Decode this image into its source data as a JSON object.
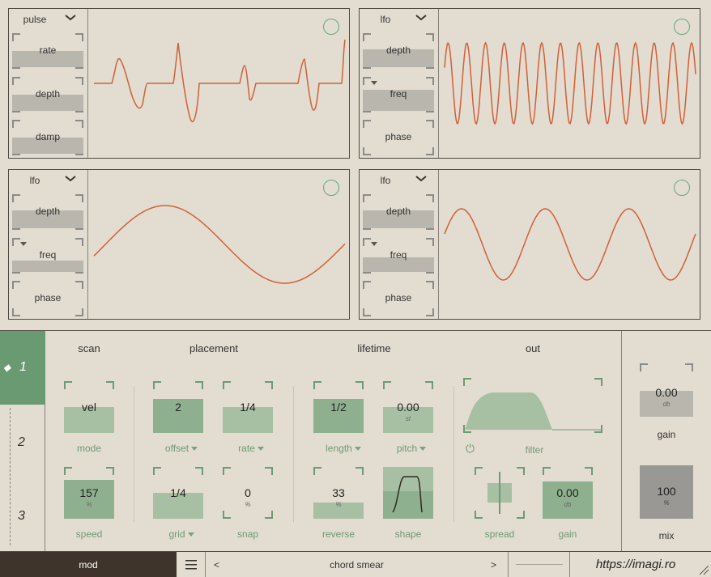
{
  "panels": [
    {
      "source": "pulse",
      "knobs": [
        {
          "label": "rate",
          "fill": 0.5,
          "arrow": false
        },
        {
          "label": "depth",
          "fill": 0.5,
          "arrow": false
        },
        {
          "label": "damp",
          "fill": 0.5,
          "arrow": false
        }
      ]
    },
    {
      "source": "lfo",
      "knobs": [
        {
          "label": "depth",
          "fill": 0.5,
          "arrow": false
        },
        {
          "label": "freq",
          "fill": 0.55,
          "arrow": true
        },
        {
          "label": "phase",
          "fill": 0,
          "arrow": false
        }
      ]
    },
    {
      "source": "lfo",
      "knobs": [
        {
          "label": "depth",
          "fill": 0.5,
          "arrow": false
        },
        {
          "label": "freq",
          "fill": 0.3,
          "arrow": true
        },
        {
          "label": "phase",
          "fill": 0,
          "arrow": false
        }
      ]
    },
    {
      "source": "lfo",
      "knobs": [
        {
          "label": "depth",
          "fill": 0.5,
          "arrow": false
        },
        {
          "label": "freq",
          "fill": 0.4,
          "arrow": true
        },
        {
          "label": "phase",
          "fill": 0,
          "arrow": false
        }
      ]
    }
  ],
  "tabs": [
    "1",
    "2",
    "3"
  ],
  "sections": {
    "scan": "scan",
    "placement": "placement",
    "lifetime": "lifetime",
    "out": "out"
  },
  "knobs": {
    "mode": {
      "value": "vel",
      "unit": "",
      "label": "mode",
      "fill": 0.5
    },
    "offset": {
      "value": "2",
      "unit": "",
      "label": "offset",
      "fill": 0.65
    },
    "rate": {
      "value": "1/4",
      "unit": "",
      "label": "rate",
      "fill": 0.5
    },
    "length": {
      "value": "1/2",
      "unit": "",
      "label": "length",
      "fill": 0.65
    },
    "pitch": {
      "value": "0.00",
      "unit": "st",
      "label": "pitch",
      "fill": 0.5
    },
    "speed": {
      "value": "157",
      "unit": "%",
      "label": "speed",
      "fill": 0.75
    },
    "grid": {
      "value": "1/4",
      "unit": "",
      "label": "grid",
      "fill": 0.5
    },
    "snap": {
      "value": "0",
      "unit": "%",
      "label": "snap",
      "fill": 0
    },
    "reverse": {
      "value": "33",
      "unit": "%",
      "label": "reverse",
      "fill": 0.33
    },
    "shape": {
      "label": "shape"
    },
    "filter": {
      "label": "filter"
    },
    "spread": {
      "label": "spread"
    },
    "out_gain": {
      "value": "0.00",
      "unit": "db",
      "label": "gain",
      "fill": 0.75
    }
  },
  "master": {
    "gain": {
      "value": "0.00",
      "unit": "db",
      "label": "gain"
    },
    "mix": {
      "value": "100",
      "unit": "%",
      "label": "mix"
    }
  },
  "footer": {
    "mod": "mod",
    "prev": "<",
    "preset": "chord smear",
    "next": ">",
    "url": "https://imagi.ro"
  },
  "colors": {
    "accent": "#6a9a72",
    "wave": "#d0603a",
    "dark": "#3e342b"
  }
}
